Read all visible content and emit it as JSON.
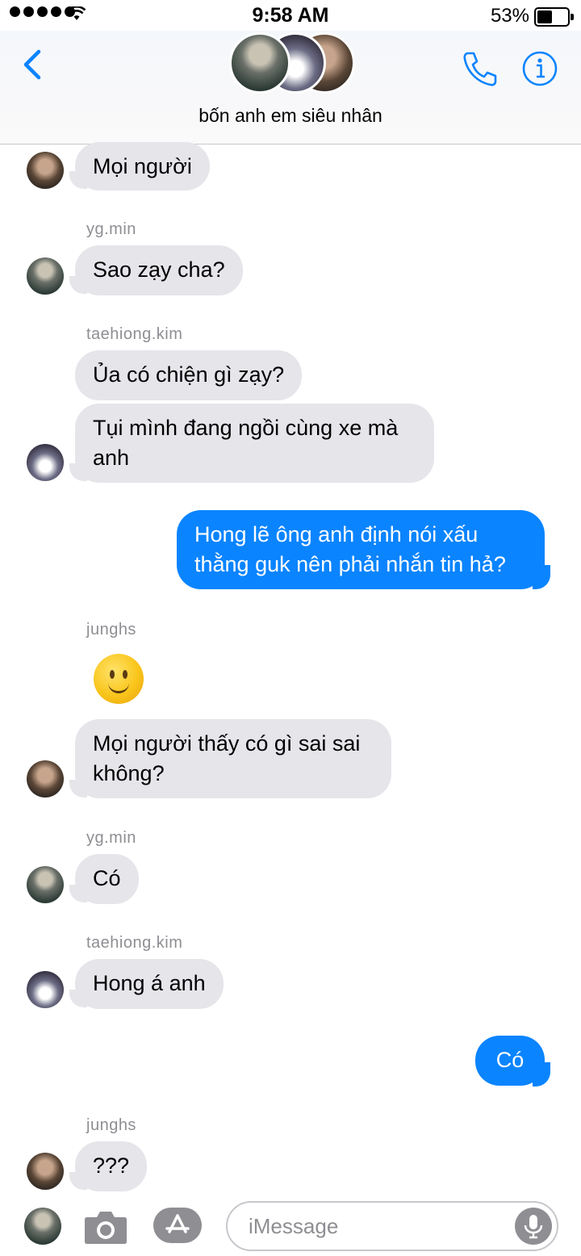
{
  "status_bar": {
    "time": "9:58 AM",
    "battery": "53%",
    "battery_level": 0.53
  },
  "header": {
    "group_name": "bốn anh em siêu nhân",
    "icons": [
      "back-chevron-icon",
      "phone-icon",
      "info-icon"
    ]
  },
  "messages": [
    {
      "sender": "",
      "text": "Mọi người"
    },
    {
      "sender": "yg.min",
      "text": "Sao zạy cha?"
    },
    {
      "sender": "taehiong.kim",
      "text": "Ủa có chiện gì zạy?"
    },
    {
      "sender": "",
      "text_line1": "Tụi mình đang ngồi cùng xe mà",
      "text_line2": "anh"
    },
    {
      "sender": "me",
      "text_line1": "Hong lẽ ông anh định nói xấu",
      "text_line2": "thằng guk nên phải nhắn tin hả?"
    },
    {
      "sender": "junghs",
      "emoji": "slightly-smiling-face"
    },
    {
      "sender": "",
      "text_line1": "Mọi người thấy có gì sai sai",
      "text_line2": "không?"
    },
    {
      "sender": "yg.min",
      "text": "Có"
    },
    {
      "sender": "taehiong.kim",
      "text": "Hong á anh"
    },
    {
      "sender": "me",
      "text": "Có"
    },
    {
      "sender": "junghs",
      "text": "???"
    }
  ],
  "composer": {
    "placeholder": "iMessage",
    "icons": [
      "camera-icon",
      "app-store-icon",
      "microphone-icon"
    ]
  },
  "colors": {
    "accent": "#0a84ff",
    "incoming_bubble": "#e5e5ea",
    "sender_text": "#8e8e93"
  }
}
